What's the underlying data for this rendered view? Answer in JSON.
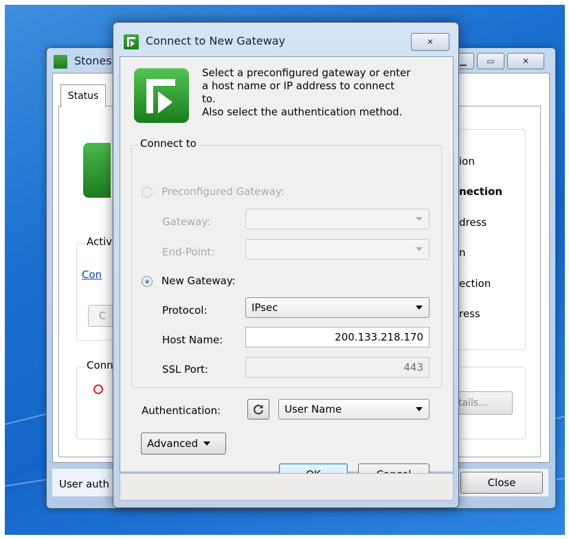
{
  "background_window": {
    "title": "Stones",
    "tab_status": "Status",
    "partial_labels": {
      "acti": "Activ",
      "con_link": "Con",
      "c_button": "C",
      "conn": "Conn",
      "ion": "ion",
      "nection": "nection",
      "dress": "dress",
      "n": "n",
      "ection": "ection",
      "ress": "ress"
    },
    "details_button": "tails...",
    "status_text": "User auth",
    "close_button": "Close"
  },
  "dialog": {
    "title": "Connect to New Gateway",
    "intro_lines": [
      "Select a preconfigured gateway or enter",
      "a host name or IP address to connect",
      "to.",
      "Also select the authentication method."
    ],
    "connect_to_legend": "Connect to",
    "preconfigured_label": "Preconfigured Gateway:",
    "gateway_label": "Gateway:",
    "gateway_value": "",
    "endpoint_label": "End-Point:",
    "endpoint_value": "",
    "new_gateway_label": "New Gateway:",
    "protocol_label": "Protocol:",
    "protocol_value": "IPsec",
    "host_name_label": "Host Name:",
    "host_name_value": "200.133.218.170",
    "ssl_port_label": "SSL Port:",
    "ssl_port_value": "443",
    "authentication_label": "Authentication:",
    "authentication_value": "User Name",
    "advanced_button": "Advanced",
    "ok_button": "OK",
    "cancel_button": "Cancel",
    "status_text": ""
  },
  "colors": {
    "accent_green": "#2a8f2a",
    "desktop_blue": "#1a6fcf",
    "link_blue": "#0645ad"
  }
}
